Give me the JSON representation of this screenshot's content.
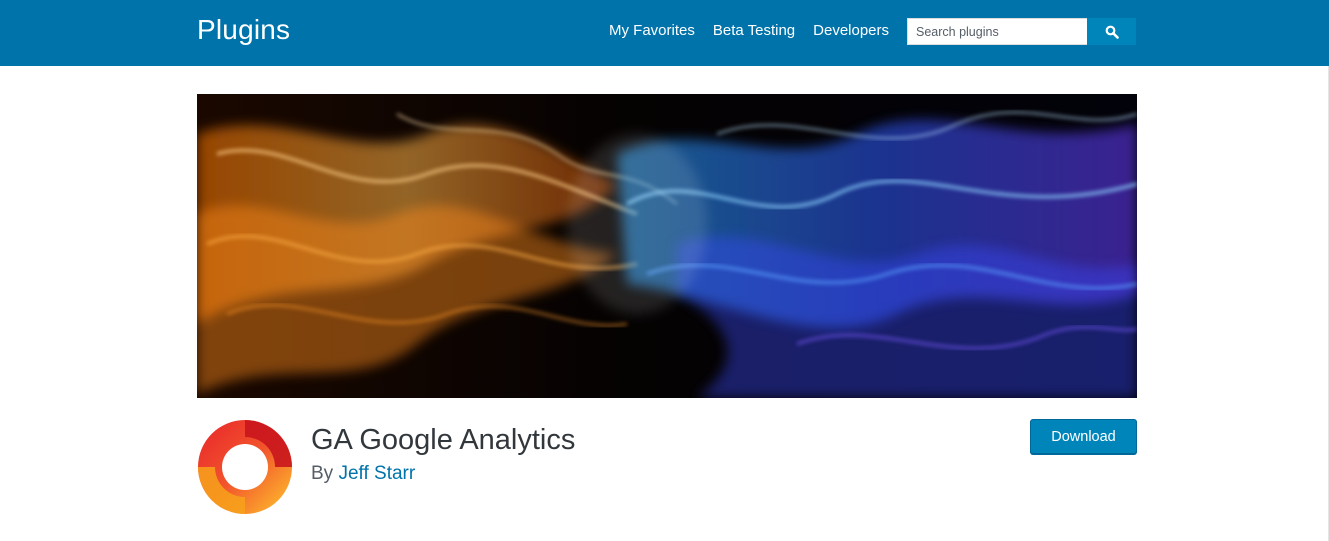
{
  "header": {
    "title": "Plugins",
    "nav": [
      {
        "label": "My Favorites"
      },
      {
        "label": "Beta Testing"
      },
      {
        "label": "Developers"
      }
    ],
    "search": {
      "placeholder": "Search plugins",
      "value": "",
      "button_icon": "search-icon"
    },
    "bg_color": "#0073aa"
  },
  "plugin": {
    "name": "GA Google Analytics",
    "by_prefix": "By",
    "author": "Jeff Starr",
    "download_label": "Download",
    "accent_color": "#0085ba"
  }
}
